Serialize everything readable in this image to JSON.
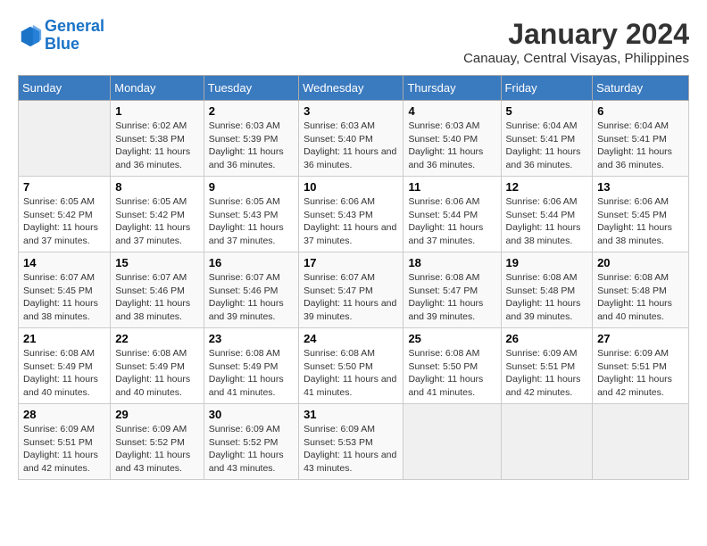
{
  "logo": {
    "line1": "General",
    "line2": "Blue"
  },
  "title": "January 2024",
  "subtitle": "Canauay, Central Visayas, Philippines",
  "headers": [
    "Sunday",
    "Monday",
    "Tuesday",
    "Wednesday",
    "Thursday",
    "Friday",
    "Saturday"
  ],
  "weeks": [
    [
      {
        "num": "",
        "sunrise": "",
        "sunset": "",
        "daylight": ""
      },
      {
        "num": "1",
        "sunrise": "Sunrise: 6:02 AM",
        "sunset": "Sunset: 5:38 PM",
        "daylight": "Daylight: 11 hours and 36 minutes."
      },
      {
        "num": "2",
        "sunrise": "Sunrise: 6:03 AM",
        "sunset": "Sunset: 5:39 PM",
        "daylight": "Daylight: 11 hours and 36 minutes."
      },
      {
        "num": "3",
        "sunrise": "Sunrise: 6:03 AM",
        "sunset": "Sunset: 5:40 PM",
        "daylight": "Daylight: 11 hours and 36 minutes."
      },
      {
        "num": "4",
        "sunrise": "Sunrise: 6:03 AM",
        "sunset": "Sunset: 5:40 PM",
        "daylight": "Daylight: 11 hours and 36 minutes."
      },
      {
        "num": "5",
        "sunrise": "Sunrise: 6:04 AM",
        "sunset": "Sunset: 5:41 PM",
        "daylight": "Daylight: 11 hours and 36 minutes."
      },
      {
        "num": "6",
        "sunrise": "Sunrise: 6:04 AM",
        "sunset": "Sunset: 5:41 PM",
        "daylight": "Daylight: 11 hours and 36 minutes."
      }
    ],
    [
      {
        "num": "7",
        "sunrise": "Sunrise: 6:05 AM",
        "sunset": "Sunset: 5:42 PM",
        "daylight": "Daylight: 11 hours and 37 minutes."
      },
      {
        "num": "8",
        "sunrise": "Sunrise: 6:05 AM",
        "sunset": "Sunset: 5:42 PM",
        "daylight": "Daylight: 11 hours and 37 minutes."
      },
      {
        "num": "9",
        "sunrise": "Sunrise: 6:05 AM",
        "sunset": "Sunset: 5:43 PM",
        "daylight": "Daylight: 11 hours and 37 minutes."
      },
      {
        "num": "10",
        "sunrise": "Sunrise: 6:06 AM",
        "sunset": "Sunset: 5:43 PM",
        "daylight": "Daylight: 11 hours and 37 minutes."
      },
      {
        "num": "11",
        "sunrise": "Sunrise: 6:06 AM",
        "sunset": "Sunset: 5:44 PM",
        "daylight": "Daylight: 11 hours and 37 minutes."
      },
      {
        "num": "12",
        "sunrise": "Sunrise: 6:06 AM",
        "sunset": "Sunset: 5:44 PM",
        "daylight": "Daylight: 11 hours and 38 minutes."
      },
      {
        "num": "13",
        "sunrise": "Sunrise: 6:06 AM",
        "sunset": "Sunset: 5:45 PM",
        "daylight": "Daylight: 11 hours and 38 minutes."
      }
    ],
    [
      {
        "num": "14",
        "sunrise": "Sunrise: 6:07 AM",
        "sunset": "Sunset: 5:45 PM",
        "daylight": "Daylight: 11 hours and 38 minutes."
      },
      {
        "num": "15",
        "sunrise": "Sunrise: 6:07 AM",
        "sunset": "Sunset: 5:46 PM",
        "daylight": "Daylight: 11 hours and 38 minutes."
      },
      {
        "num": "16",
        "sunrise": "Sunrise: 6:07 AM",
        "sunset": "Sunset: 5:46 PM",
        "daylight": "Daylight: 11 hours and 39 minutes."
      },
      {
        "num": "17",
        "sunrise": "Sunrise: 6:07 AM",
        "sunset": "Sunset: 5:47 PM",
        "daylight": "Daylight: 11 hours and 39 minutes."
      },
      {
        "num": "18",
        "sunrise": "Sunrise: 6:08 AM",
        "sunset": "Sunset: 5:47 PM",
        "daylight": "Daylight: 11 hours and 39 minutes."
      },
      {
        "num": "19",
        "sunrise": "Sunrise: 6:08 AM",
        "sunset": "Sunset: 5:48 PM",
        "daylight": "Daylight: 11 hours and 39 minutes."
      },
      {
        "num": "20",
        "sunrise": "Sunrise: 6:08 AM",
        "sunset": "Sunset: 5:48 PM",
        "daylight": "Daylight: 11 hours and 40 minutes."
      }
    ],
    [
      {
        "num": "21",
        "sunrise": "Sunrise: 6:08 AM",
        "sunset": "Sunset: 5:49 PM",
        "daylight": "Daylight: 11 hours and 40 minutes."
      },
      {
        "num": "22",
        "sunrise": "Sunrise: 6:08 AM",
        "sunset": "Sunset: 5:49 PM",
        "daylight": "Daylight: 11 hours and 40 minutes."
      },
      {
        "num": "23",
        "sunrise": "Sunrise: 6:08 AM",
        "sunset": "Sunset: 5:49 PM",
        "daylight": "Daylight: 11 hours and 41 minutes."
      },
      {
        "num": "24",
        "sunrise": "Sunrise: 6:08 AM",
        "sunset": "Sunset: 5:50 PM",
        "daylight": "Daylight: 11 hours and 41 minutes."
      },
      {
        "num": "25",
        "sunrise": "Sunrise: 6:08 AM",
        "sunset": "Sunset: 5:50 PM",
        "daylight": "Daylight: 11 hours and 41 minutes."
      },
      {
        "num": "26",
        "sunrise": "Sunrise: 6:09 AM",
        "sunset": "Sunset: 5:51 PM",
        "daylight": "Daylight: 11 hours and 42 minutes."
      },
      {
        "num": "27",
        "sunrise": "Sunrise: 6:09 AM",
        "sunset": "Sunset: 5:51 PM",
        "daylight": "Daylight: 11 hours and 42 minutes."
      }
    ],
    [
      {
        "num": "28",
        "sunrise": "Sunrise: 6:09 AM",
        "sunset": "Sunset: 5:51 PM",
        "daylight": "Daylight: 11 hours and 42 minutes."
      },
      {
        "num": "29",
        "sunrise": "Sunrise: 6:09 AM",
        "sunset": "Sunset: 5:52 PM",
        "daylight": "Daylight: 11 hours and 43 minutes."
      },
      {
        "num": "30",
        "sunrise": "Sunrise: 6:09 AM",
        "sunset": "Sunset: 5:52 PM",
        "daylight": "Daylight: 11 hours and 43 minutes."
      },
      {
        "num": "31",
        "sunrise": "Sunrise: 6:09 AM",
        "sunset": "Sunset: 5:53 PM",
        "daylight": "Daylight: 11 hours and 43 minutes."
      },
      {
        "num": "",
        "sunrise": "",
        "sunset": "",
        "daylight": ""
      },
      {
        "num": "",
        "sunrise": "",
        "sunset": "",
        "daylight": ""
      },
      {
        "num": "",
        "sunrise": "",
        "sunset": "",
        "daylight": ""
      }
    ]
  ]
}
